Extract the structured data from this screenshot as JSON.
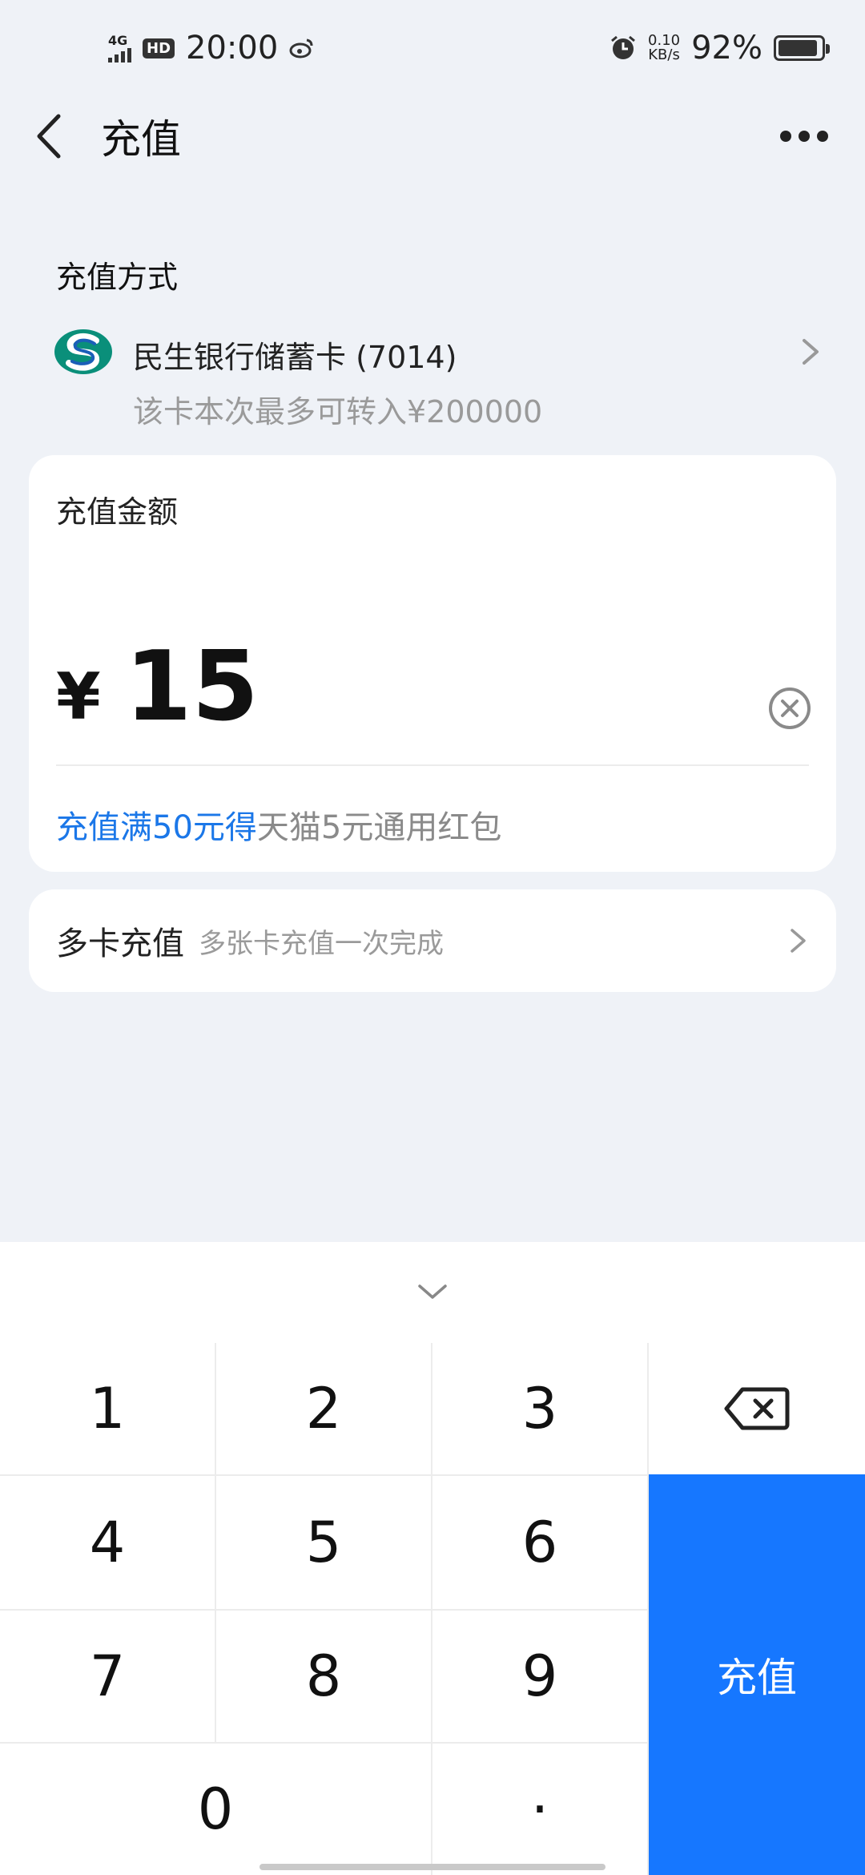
{
  "status_bar": {
    "network": "4G",
    "hd": "HD",
    "time": "20:00",
    "net_speed_value": "0.10",
    "net_speed_unit": "KB/s",
    "battery": "92%"
  },
  "header": {
    "title": "充值"
  },
  "payment_method": {
    "section_title": "充值方式",
    "bank_name": "民生银行储蓄卡 (7014)",
    "limit_text": "该卡本次最多可转入¥200000"
  },
  "amount": {
    "label": "充值金额",
    "currency": "¥",
    "value": "15",
    "promo_highlight": "充值满50元得",
    "promo_rest": "天猫5元通用红包"
  },
  "multi_card": {
    "title": "多卡充值",
    "subtitle": "多张卡充值一次完成"
  },
  "keypad": {
    "keys": [
      "1",
      "2",
      "3",
      "4",
      "5",
      "6",
      "7",
      "8",
      "9",
      "0",
      "·"
    ],
    "submit_label": "充值"
  },
  "colors": {
    "accent": "#1677ff",
    "promo": "#1b77e8",
    "background": "#eff2f7"
  }
}
